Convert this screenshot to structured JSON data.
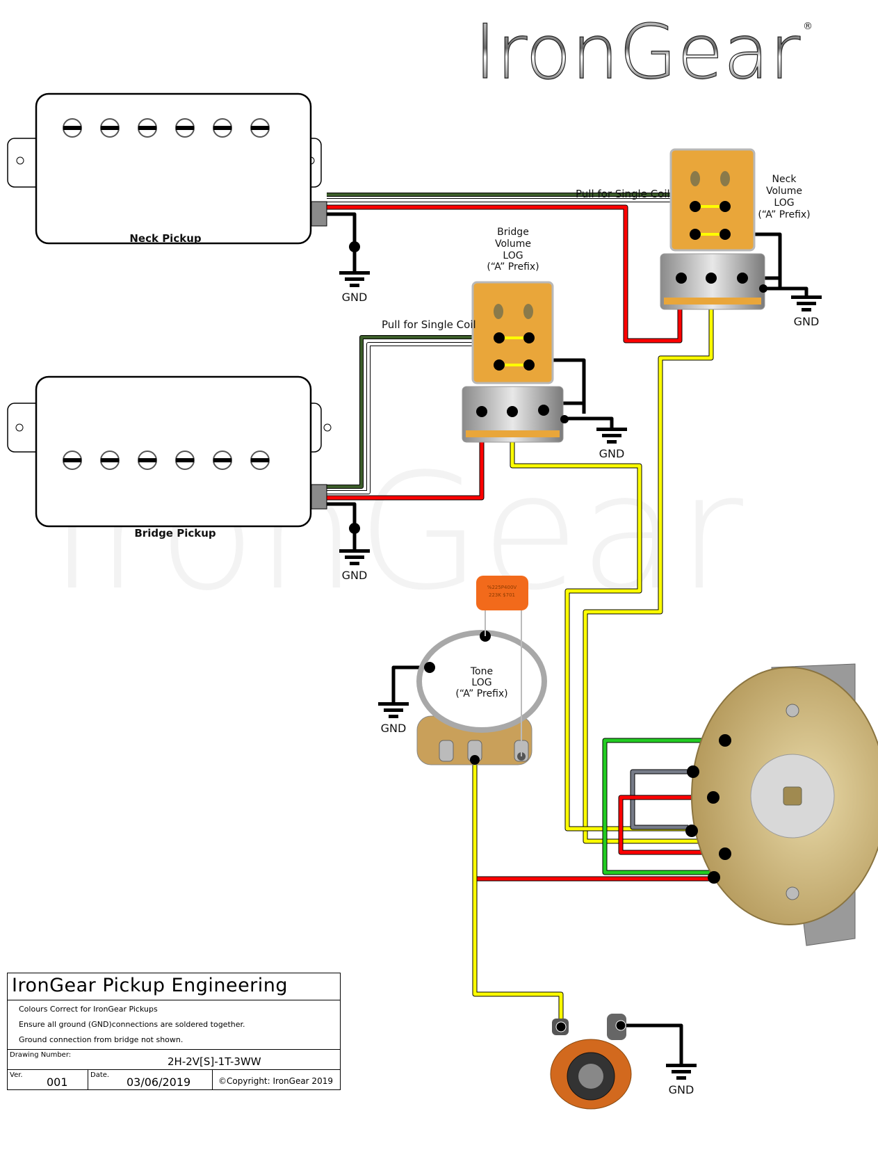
{
  "brand": {
    "logo_text": "IronGear",
    "registered_mark": "®",
    "watermark_text": "IronGear"
  },
  "pickups": {
    "neck": {
      "label": "Neck Pickup",
      "pole_count": 6
    },
    "bridge": {
      "label": "Bridge Pickup",
      "pole_count": 6
    }
  },
  "pots": {
    "neck_volume": {
      "lines": [
        "Neck",
        "Volume",
        "LOG",
        "(“A” Prefix)"
      ],
      "pull_label": "Pull for Single Coil"
    },
    "bridge_volume": {
      "lines": [
        "Bridge",
        "Volume",
        "LOG",
        "(“A” Prefix)"
      ],
      "pull_label": "Pull for Single Coil"
    },
    "tone": {
      "lines": [
        "Tone",
        "LOG",
        "(“A” Prefix)"
      ]
    }
  },
  "capacitor": {
    "lines": [
      "%225P400V",
      "223K  $701"
    ],
    "color": "#f26a1b"
  },
  "ground_labels": {
    "neck_pickup": "GND",
    "bridge_pickup": "GND",
    "neck_volume": "GND",
    "bridge_volume": "GND",
    "tone": "GND",
    "jack": "GND"
  },
  "wire_colors": {
    "red": "#ff0000",
    "yellow": "#ffff00",
    "green": "#22cc22",
    "grey": "#777c88",
    "black": "#000000",
    "white": "#ffffff",
    "bare": "#3d5e2b",
    "pot_orange": "#e9a63a",
    "switch_brass": "#c9b27a"
  },
  "title_block": {
    "title": "IronGear Pickup Engineering",
    "notes": [
      "Colours Correct for IronGear Pickups",
      "Ensure all ground (GND)connections are soldered together.",
      "Ground connection from bridge not shown."
    ],
    "drawing_number_label": "Drawing Number:",
    "drawing_number": "2H-2V[S]-1T-3WW",
    "version_label": "Ver.",
    "version": "001",
    "date_label": "Date.",
    "date": "03/06/2019",
    "copyright": "©Copyright: IronGear 2019"
  }
}
